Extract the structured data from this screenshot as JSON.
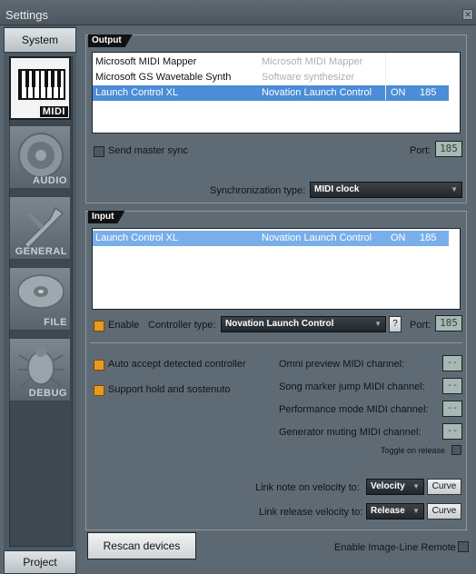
{
  "window": {
    "title": "Settings",
    "close_glyph": "✕"
  },
  "sidebar": {
    "system_tab": "System",
    "project_tab": "Project",
    "categories": [
      {
        "label": "MIDI",
        "icon": "piano-keys-icon",
        "active": true
      },
      {
        "label": "AUDIO",
        "icon": "speaker-icon",
        "active": false
      },
      {
        "label": "GENERAL",
        "icon": "wrench-icon",
        "active": false
      },
      {
        "label": "FILE",
        "icon": "disc-icon",
        "active": false
      },
      {
        "label": "DEBUG",
        "icon": "bug-icon",
        "active": false
      }
    ]
  },
  "output": {
    "header": "Output",
    "devices": [
      {
        "name": "Microsoft MIDI Mapper",
        "driver": "Microsoft MIDI Mapper",
        "status": "",
        "port": ""
      },
      {
        "name": "Microsoft GS Wavetable Synth",
        "driver": "Software synthesizer",
        "status": "",
        "port": ""
      },
      {
        "name": "Launch Control XL",
        "driver": "Novation Launch Control",
        "status": "ON",
        "port": "185"
      }
    ],
    "send_master_sync_label": "Send master sync",
    "port_label": "Port:",
    "port_value": "185",
    "sync_type_label": "Synchronization type:",
    "sync_type_value": "MIDI clock"
  },
  "input": {
    "header": "Input",
    "devices": [
      {
        "name": "Launch Control XL",
        "driver": "Novation Launch Control",
        "status": "ON",
        "port": "185"
      }
    ],
    "enable_label": "Enable",
    "controller_type_label": "Controller type:",
    "controller_type_value": "Novation Launch Control",
    "help_label": "?",
    "port_label": "Port:",
    "port_value": "185",
    "auto_accept_label": "Auto accept detected controller",
    "support_hold_label": "Support hold and sostenuto",
    "omni_label": "Omni preview MIDI channel:",
    "song_marker_label": "Song marker jump MIDI channel:",
    "performance_label": "Performance mode MIDI channel:",
    "generator_label": "Generator muting MIDI channel:",
    "channel_placeholder": "--",
    "toggle_on_release_label": "Toggle on release",
    "link_note_label": "Link note on velocity to:",
    "link_note_value": "Velocity",
    "link_release_label": "Link release velocity to:",
    "link_release_value": "Release",
    "curve_label": "Curve"
  },
  "footer": {
    "rescan_label": "Rescan devices",
    "enable_remote_label": "Enable Image-Line Remote"
  }
}
